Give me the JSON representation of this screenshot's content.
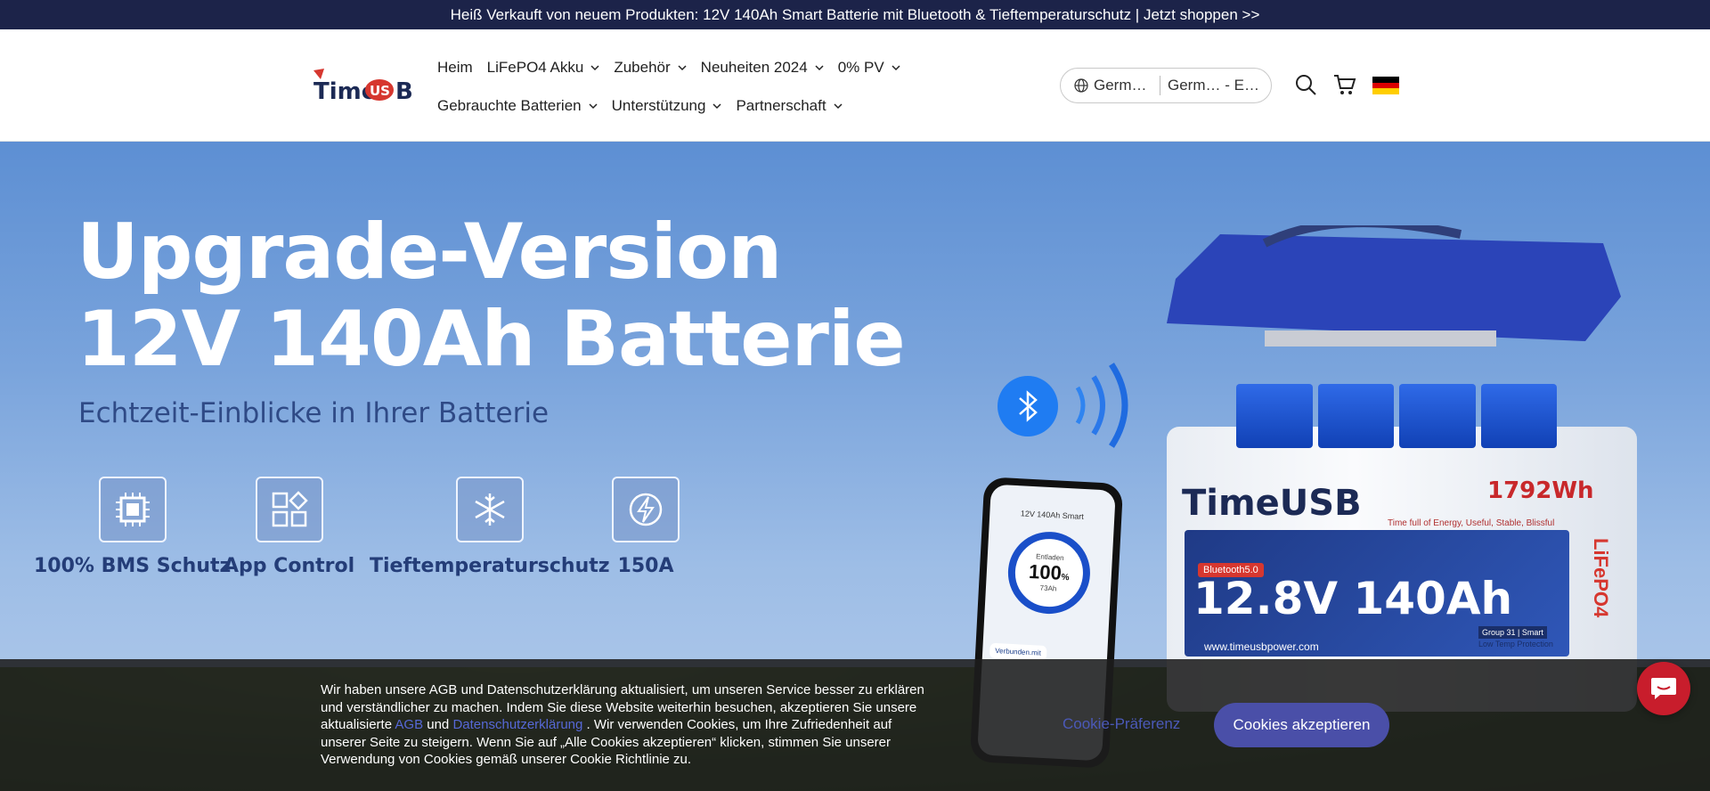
{
  "announcement": {
    "text": "Heiß Verkauft von neuem Produkten: 12V 140Ah Smart Batterie mit Bluetooth & Tieftemperaturschutz | Jetzt shoppen >>"
  },
  "header": {
    "logo_text": "TimeUSB",
    "nav_row1": [
      {
        "label": "Heim",
        "dropdown": false
      },
      {
        "label": "LiFePO4 Akku",
        "dropdown": true
      },
      {
        "label": "Zubehör",
        "dropdown": true
      },
      {
        "label": "Neuheiten 2024",
        "dropdown": true
      },
      {
        "label": "0% PV",
        "dropdown": true
      }
    ],
    "nav_row2": [
      {
        "label": "Gebrauchte Batterien",
        "dropdown": true
      },
      {
        "label": "Unterstützung",
        "dropdown": true
      },
      {
        "label": "Partnerschaft",
        "dropdown": true
      }
    ],
    "locale": {
      "language": "Germ…",
      "currency": "Germ… - E…"
    },
    "icons": [
      "globe-icon",
      "search-icon",
      "cart-icon",
      "germany-flag-icon"
    ],
    "flag_colors": [
      "#000000",
      "#dd0000",
      "#ffce00"
    ]
  },
  "hero": {
    "title_line1": "Upgrade-Version",
    "title_line2": "12V 140Ah Batterie",
    "subtitle": "Echtzeit-Einblicke in Ihrer Batterie",
    "features": [
      {
        "label": "100% BMS Schutz",
        "icon": "chip-icon"
      },
      {
        "label": "App Control",
        "icon": "apps-icon"
      },
      {
        "label": "Tieftemperaturschutz",
        "icon": "snowflake-icon"
      },
      {
        "label": "150A",
        "icon": "lightning-icon"
      }
    ],
    "phone": {
      "title": "12V 140Ah Smart",
      "status": "Entladen",
      "percent": "100",
      "percent_unit": "%",
      "capacity": "73Ah",
      "connection": "Verbunden.mit"
    },
    "battery": {
      "brand": "TimeUSB",
      "energy": "1792Wh",
      "tagline": "Time full of Energy, Useful, Stable, Blissful",
      "bluetooth_badge": "Bluetooth5.0",
      "spec": "12.8V 140Ah",
      "chemistry": "LiFePO4",
      "website": "www.timeusbpower.com",
      "group": "Group 31 | Smart",
      "low_temp": "Low Temp Protection"
    },
    "accent_colors": {
      "bluetooth": "#1f7cf2",
      "title": "#ffffff",
      "subtitle": "#2f4a86"
    }
  },
  "cookie": {
    "text_part1": "Wir haben unsere AGB und Datenschutzerklärung aktualisiert, um unseren Service besser zu erklären und verständlicher zu machen. Indem Sie diese Website weiterhin besuchen, akzeptieren Sie unsere aktualisierte ",
    "link_agb": "AGB",
    "text_and": " und ",
    "link_privacy": "Datenschutzerklärung",
    "text_part2": " . Wir verwenden Cookies, um Ihre Zufriedenheit auf unserer Seite zu steigern. Wenn Sie auf „Alle Cookies akzeptieren“ klicken, stimmen Sie unserer Verwendung von Cookies gemäß unserer Cookie Richtlinie zu.",
    "preference_label": "Cookie-Präferenz",
    "accept_label": "Cookies akzeptieren"
  },
  "chat": {
    "icon": "chat-icon",
    "color": "#c81d2c"
  }
}
